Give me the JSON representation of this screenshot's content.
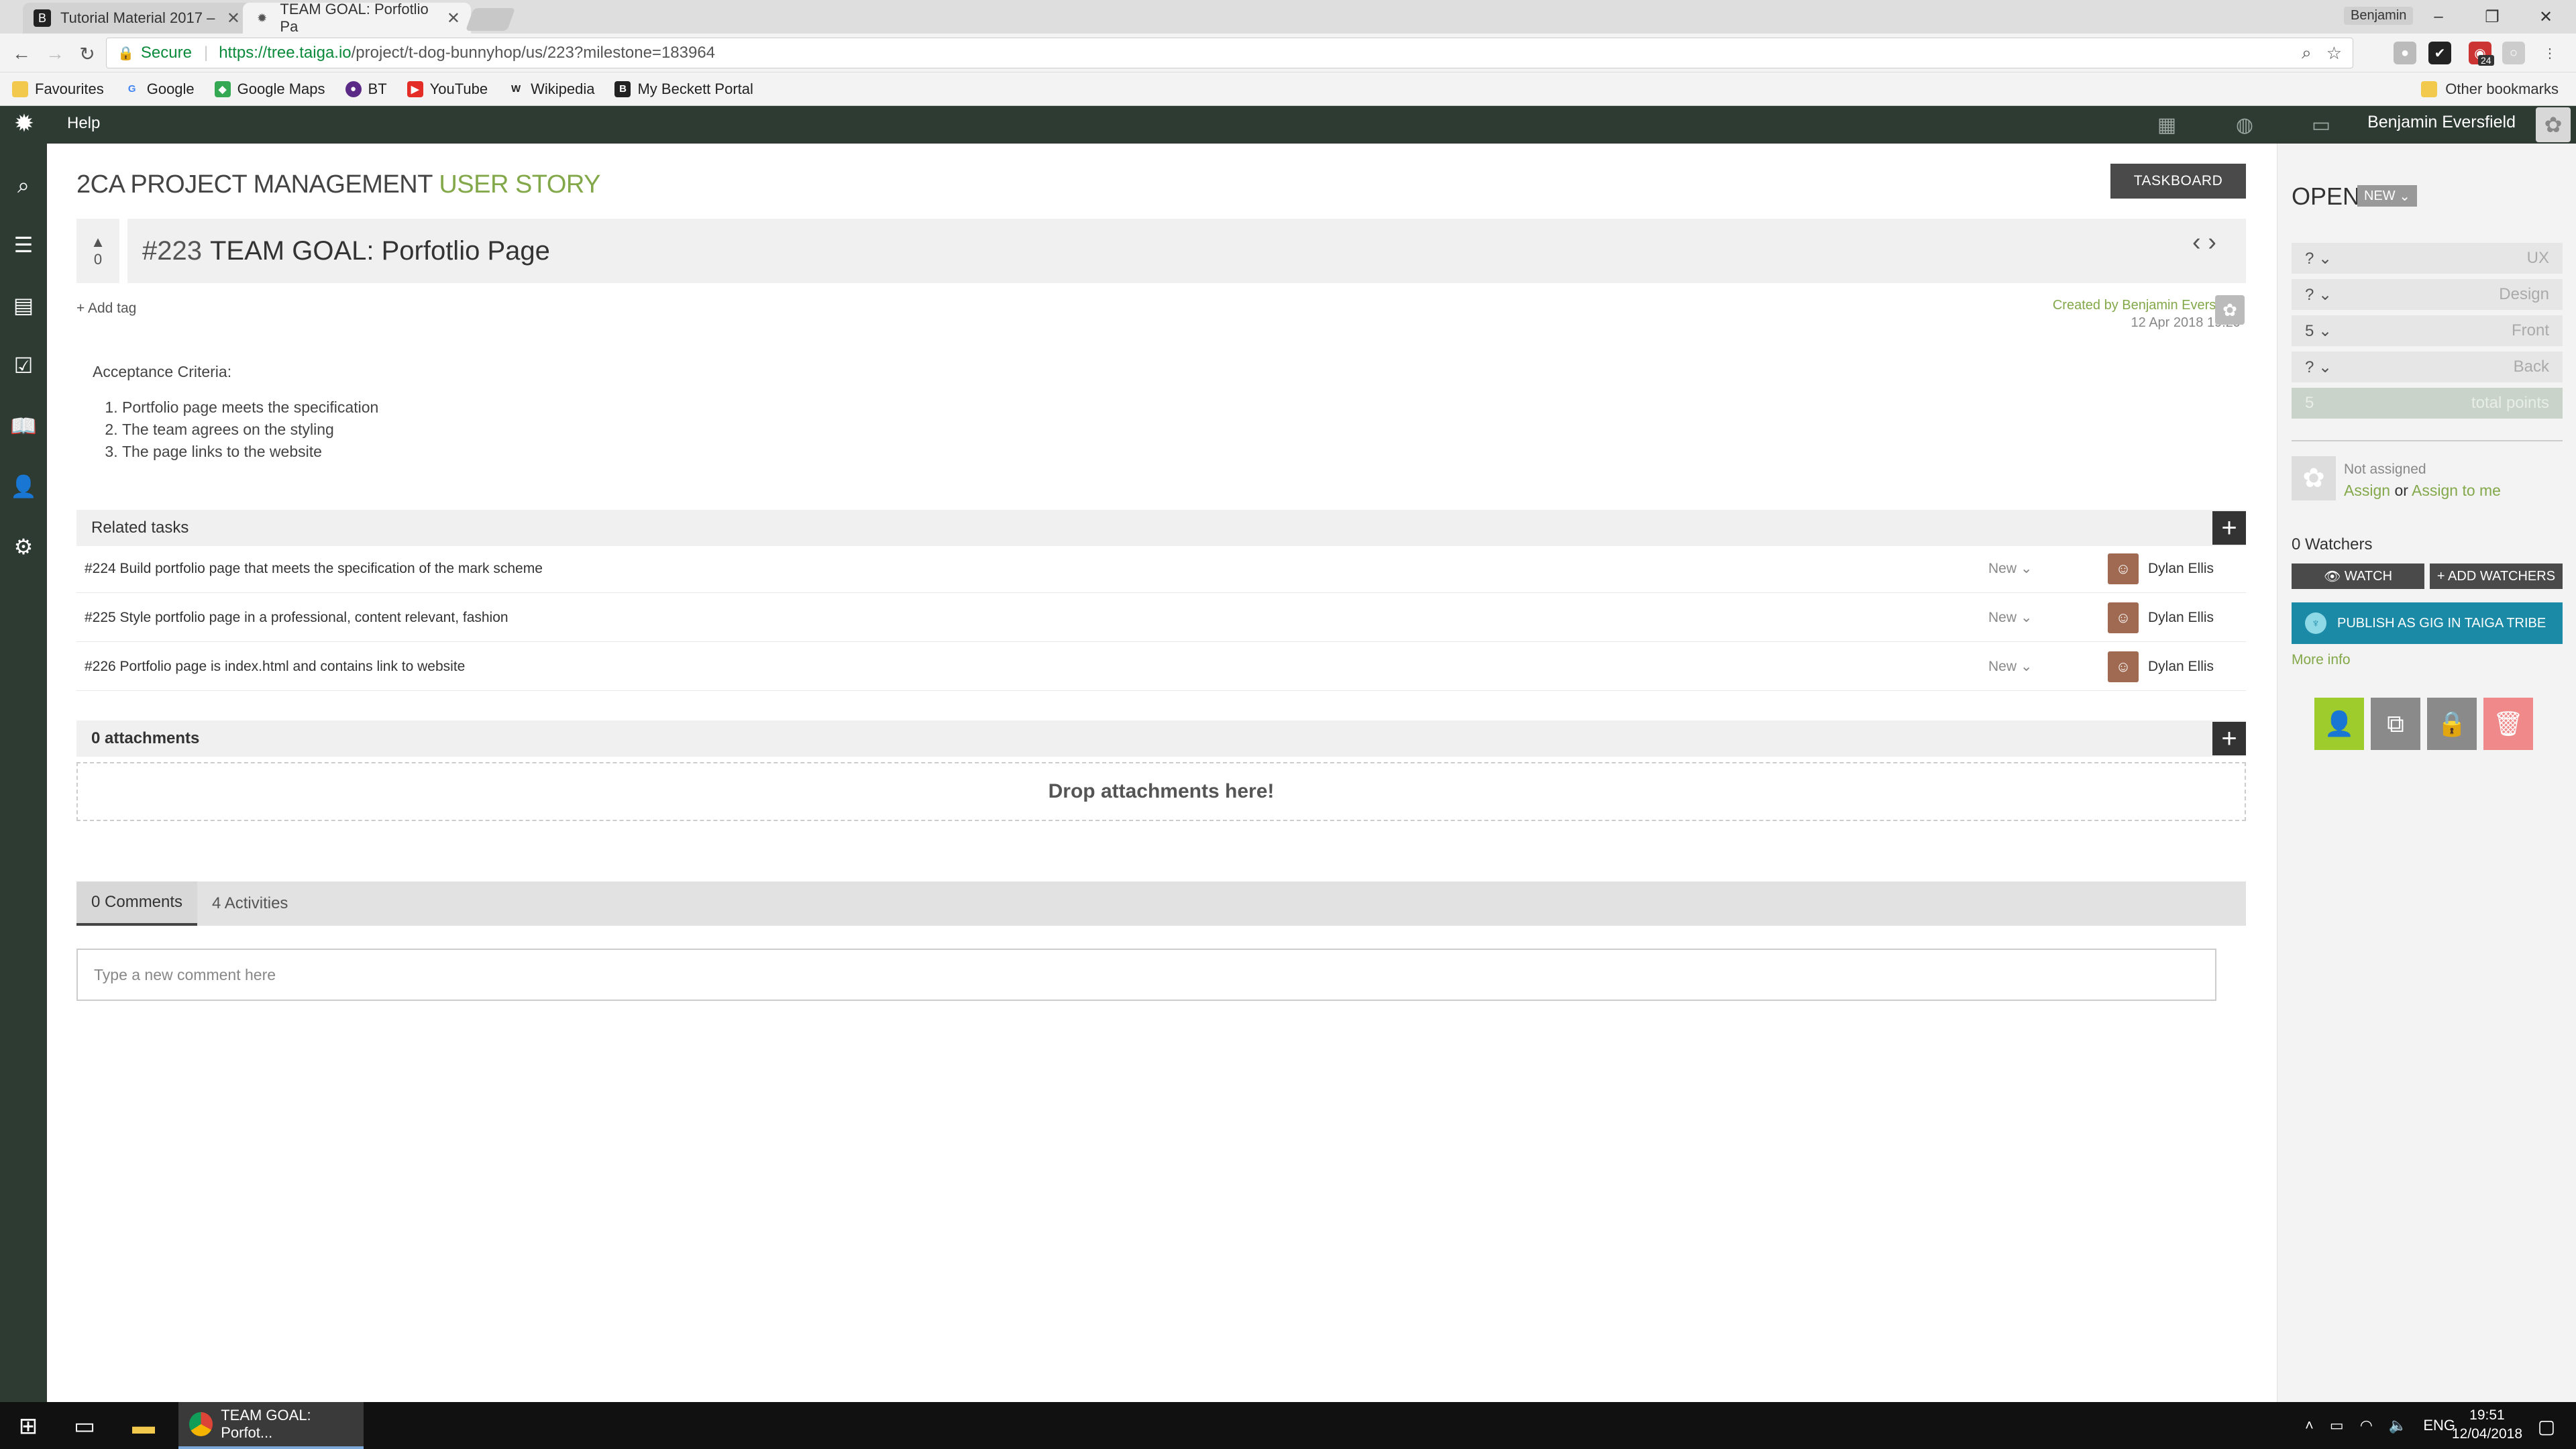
{
  "browser": {
    "tabs": [
      {
        "title": "Tutorial Material 2017 –",
        "icon": "beckett-icon"
      },
      {
        "title": "TEAM GOAL: Porfotlio Pa",
        "icon": "taiga-icon"
      }
    ],
    "user_chip": "Benjamin",
    "secure_label": "Secure",
    "url_host": "https://tree.taiga.io",
    "url_path": "/project/t-dog-bunnyhop/us/223?milestone=183964",
    "bookmarks": [
      "Favourites",
      "Google",
      "Google Maps",
      "BT",
      "YouTube",
      "Wikipedia",
      "My Beckett Portal"
    ],
    "other_bookmarks": "Other bookmarks",
    "ext_badge": "24"
  },
  "topbar": {
    "help": "Help",
    "user_name": "Benjamin Eversfield"
  },
  "header": {
    "project": "2CA PROJECT MANAGEMENT",
    "section": "USER STORY",
    "taskboard_button": "TASKBOARD"
  },
  "story": {
    "votes": "0",
    "ref": "#223",
    "title": "TEAM GOAL: Porfotlio Page",
    "add_tag": "Add tag",
    "created_by": "Created by Benjamin Eversfield",
    "created_date": "12 Apr 2018 19:29",
    "description_heading": "Acceptance Criteria:",
    "criteria": [
      "Portfolio page meets the specification",
      "The team agrees on the styling",
      "The page links to the website"
    ]
  },
  "related_tasks": {
    "heading": "Related tasks",
    "tasks": [
      {
        "label": "#224 Build portfolio page that meets the specification of the mark scheme",
        "status": "New",
        "assignee": "Dylan Ellis"
      },
      {
        "label": "#225 Style portfolio page in a professional, content relevant, fashion",
        "status": "New",
        "assignee": "Dylan Ellis"
      },
      {
        "label": "#226 Portfolio page is index.html and contains link to website",
        "status": "New",
        "assignee": "Dylan Ellis"
      }
    ]
  },
  "attachments": {
    "heading": "0 attachments",
    "drop_text": "Drop attachments here!"
  },
  "comments": {
    "tabs": [
      "0 Comments",
      "4 Activities"
    ],
    "placeholder": "Type a new comment here"
  },
  "sidebar": {
    "status": "OPEN",
    "status_badge": "NEW",
    "points": [
      {
        "value": "?",
        "role": "UX"
      },
      {
        "value": "?",
        "role": "Design"
      },
      {
        "value": "5",
        "role": "Front"
      },
      {
        "value": "?",
        "role": "Back"
      }
    ],
    "total_value": "5",
    "total_label": "total points",
    "not_assigned": "Not assigned",
    "assign": "Assign",
    "or": "or",
    "assign_to_me": "Assign to me",
    "watchers": "0 Watchers",
    "watch_button": "WATCH",
    "add_watchers_button": "+ ADD WATCHERS",
    "publish_button": "PUBLISH AS GIG IN TAIGA TRIBE",
    "more_info": "More info"
  },
  "taskbar": {
    "chrome_task": "TEAM GOAL: Porfot...",
    "language": "ENG",
    "time": "19:51",
    "date": "12/04/2018"
  },
  "colors": {
    "accent": "#83a84a",
    "topbar": "#2d3b33",
    "publish": "#1b8aa6"
  }
}
